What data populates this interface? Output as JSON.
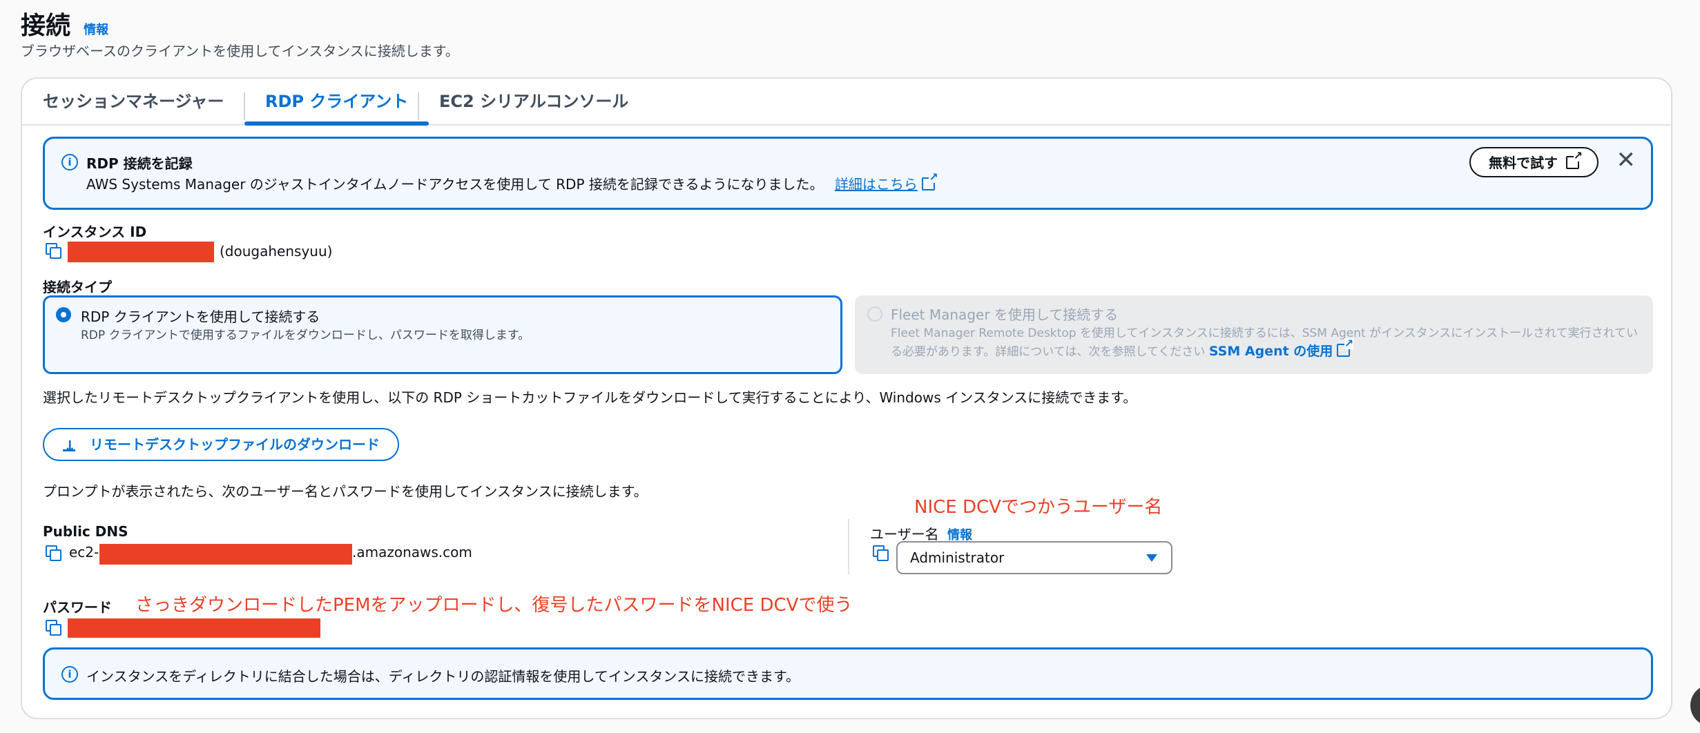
{
  "page": {
    "title": "接続",
    "info_link": "情報",
    "description": "ブラウザベースのクライアントを使用してインスタンスに接続します。"
  },
  "tabs": [
    {
      "label": "セッションマネージャー",
      "active": false
    },
    {
      "label": "RDP クライアント",
      "active": true
    },
    {
      "label": "EC2 シリアルコンソール",
      "active": false
    }
  ],
  "rdp_alert": {
    "title": "RDP 接続を記録",
    "body": "AWS Systems Manager のジャストインタイムノードアクセスを使用して RDP 接続を記録できるようになりました。",
    "link": "詳細はこちら",
    "try_button": "無料で試す"
  },
  "instance_id": {
    "label": "インスタンス ID",
    "name_suffix": "(dougahensyuu)"
  },
  "connection_type": {
    "label": "接続タイプ",
    "options": [
      {
        "title": "RDP クライアントを使用して接続する",
        "desc": "RDP クライアントで使用するファイルをダウンロードし、パスワードを取得します。",
        "selected": true
      },
      {
        "title": "Fleet Manager を使用して接続する",
        "desc": "Fleet Manager Remote Desktop を使用してインスタンスに接続するには、SSM Agent がインスタンスにインストールされて実行されている必要があります。詳細については、次を参照してください",
        "link": "SSM Agent の使用",
        "selected": false
      }
    ]
  },
  "instructions": "選択したリモートデスクトップクライアントを使用し、以下の RDP ショートカットファイルをダウンロードして実行することにより、Windows インスタンスに接続できます。",
  "download_button": "リモートデスクトップファイルのダウンロード",
  "prompt_text": "プロンプトが表示されたら、次のユーザー名とパスワードを使用してインスタンスに接続します。",
  "public_dns": {
    "label": "Public DNS",
    "prefix": "ec2-",
    "suffix": ".amazonaws.com"
  },
  "username": {
    "label": "ユーザー名",
    "info_link": "情報",
    "value": "Administrator"
  },
  "password": {
    "label": "パスワード"
  },
  "annotations": {
    "username_note": "NICE  DCVでつかうユーザー名",
    "password_note": "さっきダウンロードしたPEMをアップロードし、復号したパスワードをNICE DCVで使う"
  },
  "directory_alert": {
    "body": "インスタンスをディレクトリに結合した場合は、ディレクトリの認証情報を使用してインスタンスに接続できます。"
  },
  "colors": {
    "accent": "#0972d3",
    "redaction": "#ea4025",
    "annotation": "#ea4025"
  }
}
